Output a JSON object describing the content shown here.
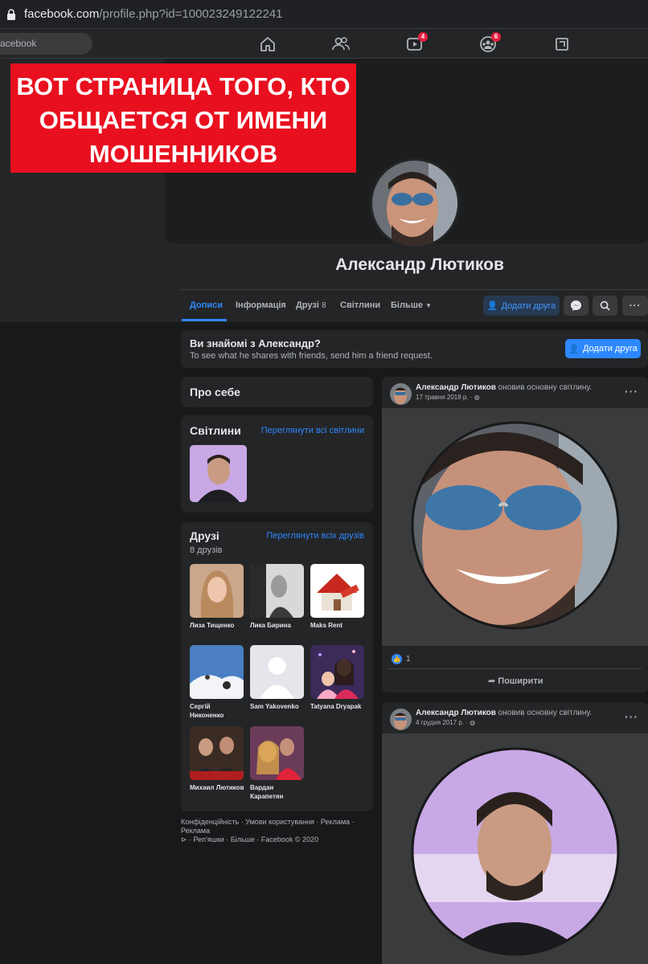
{
  "browser": {
    "url_domain": "facebook.com",
    "url_path": "/profile.php?id=100023249122241"
  },
  "header": {
    "search_placeholder": "acebook",
    "badges": {
      "watch": "4",
      "groups": "6"
    }
  },
  "banner": {
    "line1": "ВОТ СТРАНИЦА ТОГО, КТО",
    "line2": "ОБЩАЕТСЯ ОТ ИМЕНИ",
    "line3": "МОШЕННИКОВ"
  },
  "profile": {
    "name": "Александр Лютиков"
  },
  "tabs": [
    {
      "label": "Дописи"
    },
    {
      "label": "Інформація"
    },
    {
      "label": "Друзі"
    },
    {
      "label": "Світлини"
    },
    {
      "label": "Більше"
    }
  ],
  "friends_tab_count": "8",
  "actions": {
    "add_friend": "Додати друга"
  },
  "know": {
    "title": "Ви знайомі з Александр?",
    "subtitle": "To see what he shares with friends, send him a friend request.",
    "button": "Додати друга"
  },
  "about": {
    "title": "Про себе"
  },
  "photos": {
    "title": "Світлини",
    "link": "Переглянути всі світлини"
  },
  "friends": {
    "title": "Друзі",
    "count": "8 друзів",
    "link": "Переглянути всіх друзів",
    "items": [
      {
        "name": "Лиза Тищенко"
      },
      {
        "name": "Лика Бирина"
      },
      {
        "name": "Maks Rent"
      },
      {
        "name": "Сергій Никоненко"
      },
      {
        "name": "Sam Yakovenko"
      },
      {
        "name": "Tatyana Dryapak"
      },
      {
        "name": "Михаил Лютиков"
      },
      {
        "name": "Вардан Карапетян"
      }
    ]
  },
  "footer": {
    "line1": "Конфіденційність · Умови користування · Реклама · Реклама",
    "line2": "· Реп'яшки · Більше · Facebook © 2020"
  },
  "posts": [
    {
      "author": "Александр Лютиков",
      "action": "оновив основну світлину.",
      "date": "17 травня 2018 р. ·",
      "likes": "1",
      "share": "Поширити"
    },
    {
      "author": "Александр Лютиков",
      "action": "оновив основну світлину.",
      "date": "4 грудня 2017 р. ·"
    }
  ],
  "colors": {
    "accent": "#2d88ff",
    "banner": "#e8101f",
    "background": "#18191a",
    "card": "#242526"
  }
}
